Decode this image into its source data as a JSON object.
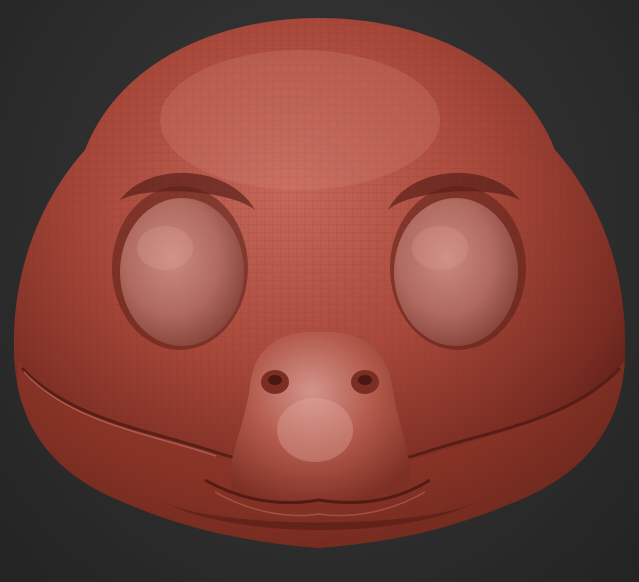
{
  "viewport": {
    "background": "#2e2e2e",
    "material_color": "#a8483a",
    "wireframe_color": "#6f2a22",
    "highlight_color": "#d88f82",
    "shadow_color": "#4a1812"
  },
  "model": {
    "icon": "sculpt-head-icon"
  }
}
